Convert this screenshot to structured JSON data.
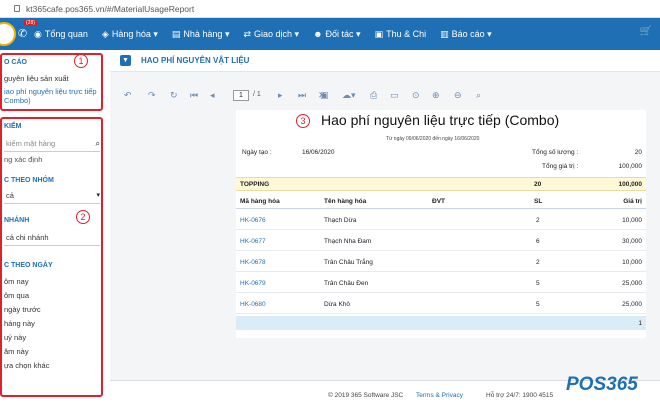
{
  "browser": {
    "url": "kt365cafe.pos365.vn/#/MaterialUsageReport"
  },
  "nav": {
    "badge": "(28)",
    "items": [
      {
        "icon": "◉",
        "label": "Tổng quan"
      },
      {
        "icon": "◈",
        "label": "Hàng hóa ▾"
      },
      {
        "icon": "▤",
        "label": "Nhà hàng ▾"
      },
      {
        "icon": "⇄",
        "label": "Giao dịch ▾"
      },
      {
        "icon": "☻",
        "label": "Đối tác ▾"
      },
      {
        "icon": "▣",
        "label": "Thu & Chi"
      },
      {
        "icon": "▥",
        "label": "Báo cáo ▾"
      }
    ]
  },
  "sidebar": {
    "report_title": "O CÁO",
    "report_items": [
      "guyên liệu sản xuất",
      "iao phí nguyên liệu trực tiếp",
      "Combo)"
    ],
    "search_title": "KIẾM",
    "search_placeholder": "kiếm mặt hàng",
    "not_set": "ng xác định",
    "group_title": "C THEO NHÓM",
    "group_value": "cả",
    "branch_title": "NHÁNH",
    "branch_value": "cả chi nhánh",
    "date_title": "C THEO NGÀY",
    "date_items": [
      "ôm nay",
      "ôm qua",
      "ngày trước",
      "háng này",
      "uý này",
      "ăm này",
      "ựa chọn khác"
    ],
    "marker1": "1",
    "marker2": "2"
  },
  "header": {
    "title": "HAO PHÍ NGUYÊN VẬT LIỆU"
  },
  "viewer": {
    "page": "1",
    "pages": "/ 1"
  },
  "report": {
    "marker3": "3",
    "title": "Hao phí nguyên liệu trực tiếp (Combo)",
    "date_range": "Từ ngày 09/06/2020 đến ngày 16/06/2020",
    "created_label": "Ngày tạo :",
    "created_value": "16/06/2020",
    "total_qty_label": "Tổng số lượng :",
    "total_qty_value": "20",
    "total_value_label": "Tổng giá trị :",
    "total_value_value": "100,000",
    "group_name": "TOPPING",
    "group_qty": "20",
    "group_value": "100,000",
    "columns": [
      "Mã hàng hóa",
      "Tên hàng hóa",
      "ĐVT",
      "SL",
      "Giá trị"
    ],
    "rows": [
      {
        "code": "HK-0676",
        "name": "Thạch Dừa",
        "qty": "2",
        "value": "10,000"
      },
      {
        "code": "HK-0677",
        "name": "Thạch Nha Đam",
        "qty": "6",
        "value": "30,000"
      },
      {
        "code": "HK-0678",
        "name": "Trân Châu Trắng",
        "qty": "2",
        "value": "10,000"
      },
      {
        "code": "HK-0679",
        "name": "Trân Châu Đen",
        "qty": "5",
        "value": "25,000"
      },
      {
        "code": "HK-0680",
        "name": "Dừa Khô",
        "qty": "5",
        "value": "25,000"
      }
    ],
    "footer_page": "1"
  },
  "footer": {
    "copyright": "© 2019 365 Software JSC",
    "terms": "Terms & Privacy",
    "hotline": "Hỗ trợ 24/7: 1900 4515"
  },
  "brand": {
    "logo": "POS365"
  }
}
